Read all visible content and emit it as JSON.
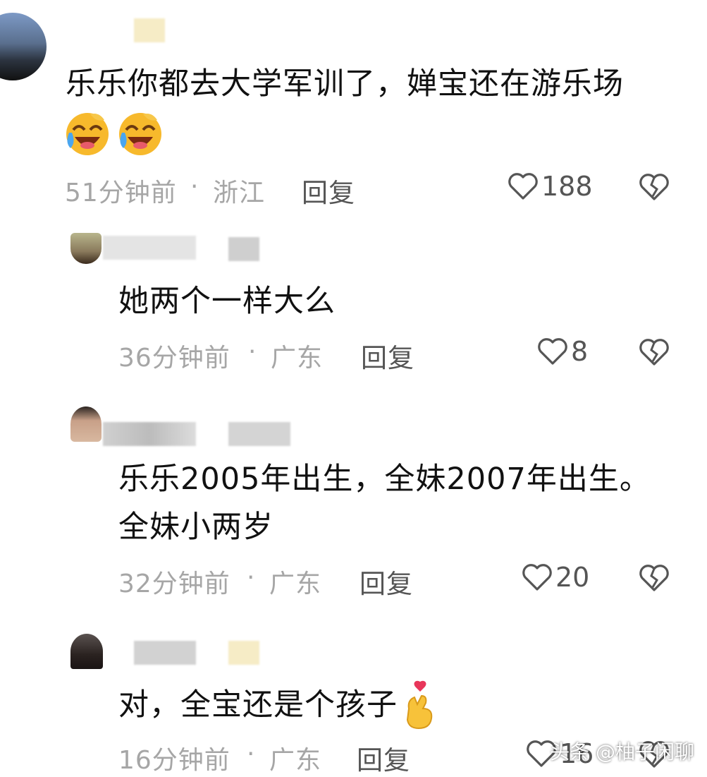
{
  "comments": [
    {
      "text_line1": "乐乐你都去大学军训了，婵宝还在游乐场",
      "time": "51分钟前",
      "location": "浙江",
      "reply_label": "回复",
      "likes": "188",
      "emojis": [
        "laugh-cry-emoji",
        "laugh-cry-emoji"
      ]
    },
    {
      "text_line1": "她两个一样大么",
      "time": "36分钟前",
      "location": "广东",
      "reply_label": "回复",
      "likes": "8"
    },
    {
      "text_line1": "乐乐2005年出生，全妹2007年出生。",
      "text_line2": "全妹小两岁",
      "time": "32分钟前",
      "location": "广东",
      "reply_label": "回复",
      "likes": "20"
    },
    {
      "text_line1": "对，全宝还是个孩子",
      "time": "16分钟前",
      "location": "广东",
      "reply_label": "回复",
      "likes": "16",
      "emojis": [
        "finger-heart-emoji"
      ]
    }
  ],
  "separator": "·",
  "watermark": "头条 @柚子闲聊",
  "colors": {
    "meta_text": "#a6a6a6",
    "action_text": "#555555",
    "body_text": "#111111"
  }
}
